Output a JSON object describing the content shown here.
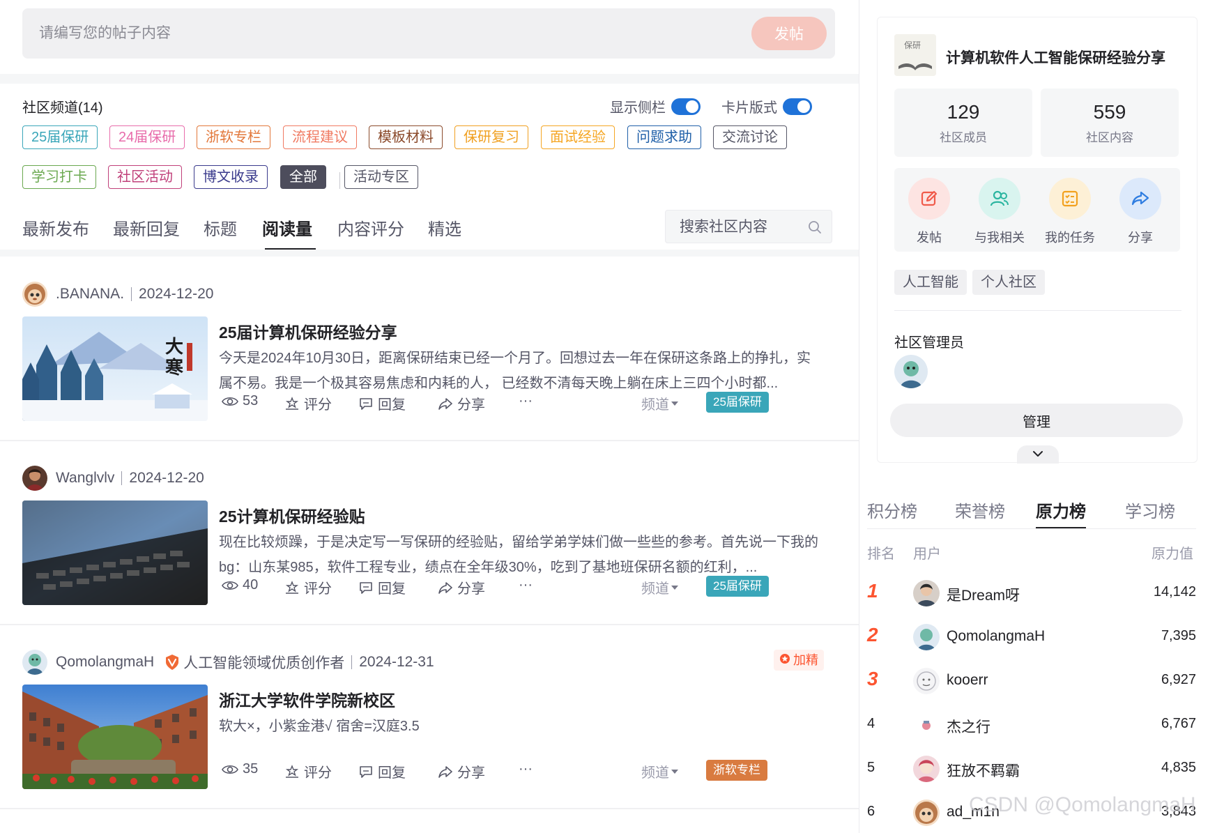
{
  "composer": {
    "placeholder": "请编写您的帖子内容",
    "post_label": "发帖"
  },
  "channels": {
    "heading": "社区频道(14)",
    "show_sidebar_label": "显示侧栏",
    "card_mode_label": "卡片版式",
    "tags": [
      {
        "label": "25届保研",
        "color": "#3aa6b9"
      },
      {
        "label": "24届保研",
        "color": "#e86cab"
      },
      {
        "label": "浙软专栏",
        "color": "#e2773a"
      },
      {
        "label": "流程建议",
        "color": "#f07a62"
      },
      {
        "label": "模板材料",
        "color": "#8b4a2b"
      },
      {
        "label": "保研复习",
        "color": "#f0a020"
      },
      {
        "label": "面试经验",
        "color": "#f5a623"
      },
      {
        "label": "问题求助",
        "color": "#1f5fa8"
      },
      {
        "label": "交流讨论",
        "color": "#555666"
      },
      {
        "label": "学习打卡",
        "color": "#6aa84f"
      },
      {
        "label": "社区活动",
        "color": "#c0407a"
      },
      {
        "label": "博文收录",
        "color": "#3a3a8c"
      },
      {
        "label": "全部",
        "color": "#4d4d5c"
      },
      {
        "label": "活动专区",
        "color": "#555666"
      }
    ]
  },
  "sort_tabs": [
    "最新发布",
    "最新回复",
    "标题",
    "阅读量",
    "内容评分",
    "精选"
  ],
  "search": {
    "placeholder": "搜索社区内容"
  },
  "posts": [
    {
      "author": ".BANANA.",
      "date": "2024-12-20",
      "title": "25届计算机保研经验分享",
      "excerpt": "今天是2024年10月30日，距离保研结束已经一个月了。回想过去一年在保研这条路上的挣扎，实属不易。我是一个极其容易焦虑和内耗的人， 已经数不清每天晚上躺在床上三四个小时都...",
      "views": "53",
      "rate_label": "评分",
      "reply_label": "回复",
      "share_label": "分享",
      "more_label": "···",
      "channel_label": "频道",
      "channel_tag": "25届保研",
      "channel_color": "#3aa6b9"
    },
    {
      "author": "Wanglvlv",
      "date": "2024-12-20",
      "title": "25计算机保研经验贴",
      "excerpt": "现在比较烦躁，于是决定写一写保研的经验贴，留给学弟学妹们做一些些的参考。首先说一下我的bg：山东某985，软件工程专业，绩点在全年级30%，吃到了基地班保研名额的红利，...",
      "views": "40",
      "rate_label": "评分",
      "reply_label": "回复",
      "share_label": "分享",
      "more_label": "···",
      "channel_label": "频道",
      "channel_tag": "25届保研",
      "channel_color": "#3aa6b9"
    },
    {
      "author": "QomolangmaH",
      "badge_text": "人工智能领域优质创作者",
      "date": "2024-12-31",
      "boost_label": "加精",
      "title": "浙江大学软件学院新校区",
      "excerpt": "软大×，小紫金港√ 宿舍=汉庭3.5",
      "views": "35",
      "rate_label": "评分",
      "reply_label": "回复",
      "share_label": "分享",
      "more_label": "···",
      "channel_label": "频道",
      "channel_tag": "浙软专栏",
      "channel_color": "#d97b40"
    }
  ],
  "community": {
    "logo_text": "保研",
    "title": "计算机软件人工智能保研经验分享",
    "members": "129",
    "members_label": "社区成员",
    "contents": "559",
    "contents_label": "社区内容",
    "quick_actions": [
      {
        "label": "发帖",
        "icon": "edit-icon",
        "bg": "#fde4e2",
        "fg": "#f05a4a"
      },
      {
        "label": "与我相关",
        "icon": "users-icon",
        "bg": "#d9f4ef",
        "fg": "#2bb5a0"
      },
      {
        "label": "我的任务",
        "icon": "task-icon",
        "bg": "#fdf0d6",
        "fg": "#f2a11e"
      },
      {
        "label": "分享",
        "icon": "share-icon",
        "bg": "#dce9fb",
        "fg": "#2f7de1"
      }
    ],
    "tags": [
      "人工智能",
      "个人社区"
    ],
    "admin_heading": "社区管理员",
    "manage_label": "管理"
  },
  "leaderboard": {
    "tabs": [
      "积分榜",
      "荣誉榜",
      "原力榜",
      "学习榜"
    ],
    "col_rank": "排名",
    "col_user": "用户",
    "col_value": "原力值",
    "rows": [
      {
        "rank": "1",
        "name": "是Dream呀",
        "value": "14,142"
      },
      {
        "rank": "2",
        "name": "QomolangmaH",
        "value": "7,395"
      },
      {
        "rank": "3",
        "name": "kooerr",
        "value": "6,927"
      },
      {
        "rank": "4",
        "name": "杰之行",
        "value": "6,767"
      },
      {
        "rank": "5",
        "name": "狂放不羁霸",
        "value": "4,835"
      },
      {
        "rank": "6",
        "name": "ad_m1n",
        "value": "3,843"
      }
    ]
  },
  "watermark": "CSDN @QomolangmaH"
}
